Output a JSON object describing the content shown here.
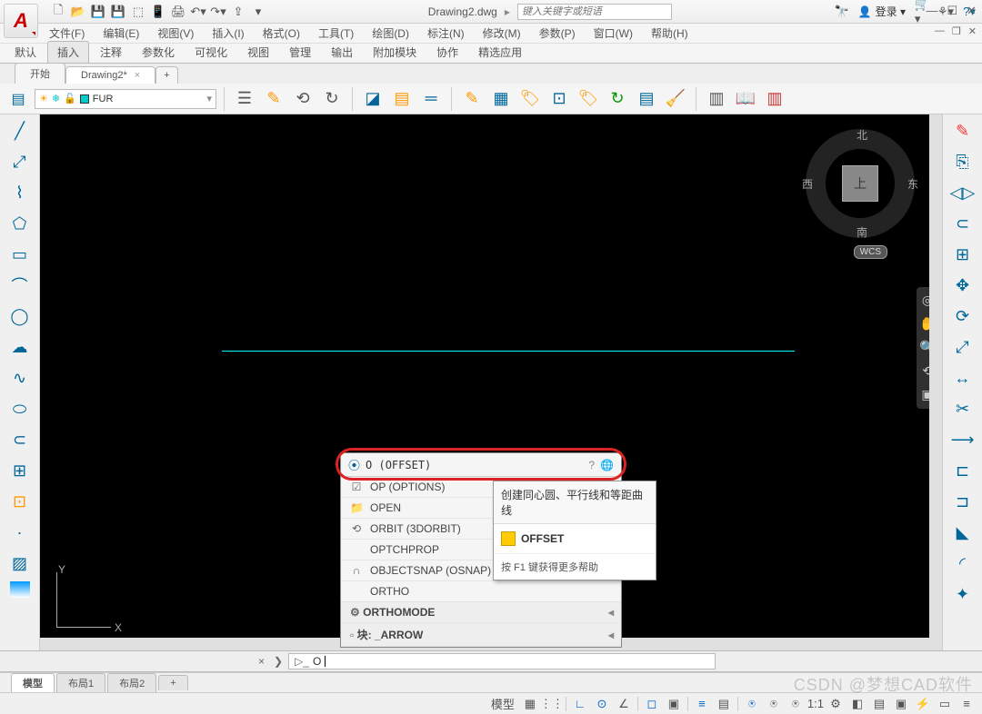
{
  "title": {
    "doc": "Drawing2.dwg",
    "search_ph": "键入关键字或短语",
    "login": "登录"
  },
  "menus": [
    "文件(F)",
    "编辑(E)",
    "视图(V)",
    "插入(I)",
    "格式(O)",
    "工具(T)",
    "绘图(D)",
    "标注(N)",
    "修改(M)",
    "参数(P)",
    "窗口(W)",
    "帮助(H)"
  ],
  "ribbon_tabs": [
    "默认",
    "插入",
    "注释",
    "参数化",
    "可视化",
    "视图",
    "管理",
    "输出",
    "附加模块",
    "协作",
    "精选应用"
  ],
  "ribbon_active": 1,
  "doc_tabs": {
    "start": "开始",
    "active": "Drawing2*"
  },
  "layer": {
    "name": "FUR"
  },
  "viewcube": {
    "n": "北",
    "s": "南",
    "e": "东",
    "w": "西",
    "top": "上",
    "wcs": "WCS"
  },
  "ucs": {
    "x": "X",
    "y": "Y"
  },
  "suggest": {
    "input": "O (OFFSET)",
    "items": [
      {
        "icon": "☑",
        "text": "OP (OPTIONS)"
      },
      {
        "icon": "📁",
        "text": "OPEN"
      },
      {
        "icon": "⟲",
        "text": "ORBIT (3DORBIT)"
      },
      {
        "icon": "",
        "text": "OPTCHPROP"
      },
      {
        "icon": "∩",
        "text": "OBJECTSNAP (OSNAP)"
      },
      {
        "icon": "",
        "text": "ORTHO"
      }
    ],
    "sys1": "ORTHOMODE",
    "sys2": "块: _ARROW"
  },
  "tooltip": {
    "desc": "创建同心圆、平行线和等距曲线",
    "name": "OFFSET",
    "help": "按 F1 键获得更多帮助"
  },
  "cmd": {
    "typed": "O"
  },
  "layouts": [
    "模型",
    "布局1",
    "布局2"
  ],
  "status": {
    "model": "模型",
    "scale": "1:1"
  },
  "watermark": "CSDN @梦想CAD软件"
}
